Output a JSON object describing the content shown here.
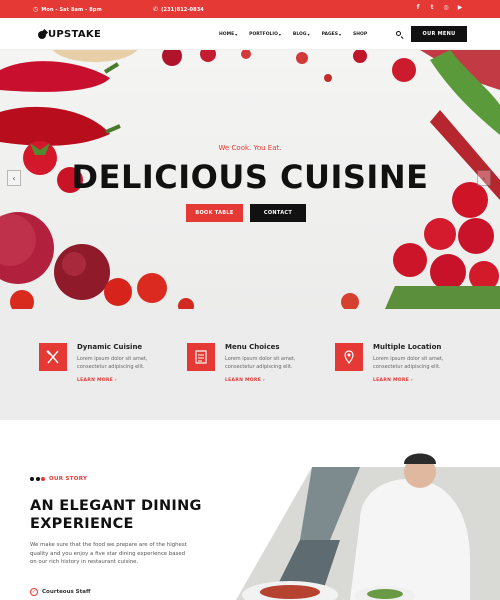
{
  "topbar": {
    "hours": "Mon - Sat 8am - 8pm",
    "phone": "(231)812-0834",
    "socials": [
      {
        "icon": "facebook-icon",
        "glyph": "f"
      },
      {
        "icon": "twitter-icon",
        "glyph": "t"
      },
      {
        "icon": "instagram-icon",
        "glyph": "◎"
      },
      {
        "icon": "youtube-icon",
        "glyph": "▶"
      }
    ]
  },
  "header": {
    "logo": "UPSTAKE",
    "nav": [
      {
        "label": "HOME",
        "has_dropdown": true
      },
      {
        "label": "PORTFOLIO",
        "has_dropdown": true
      },
      {
        "label": "BLOG",
        "has_dropdown": true
      },
      {
        "label": "PAGES",
        "has_dropdown": true
      },
      {
        "label": "SHOP",
        "has_dropdown": false
      }
    ],
    "menu_button": "OUR MENU"
  },
  "hero": {
    "eyebrow": "We Cook. You Eat.",
    "headline": "DELICIOUS CUISINE",
    "book_button": "BOOK TABLE",
    "contact_button": "CONTACT",
    "prev_arrow": "‹",
    "next_arrow": "›"
  },
  "features": [
    {
      "title": "Dynamic Cuisine",
      "desc": "Lorem ipsum dolor sit amet, consectetur adipiscing elit.",
      "link": "LEARN MORE ›",
      "icon": "utensils-icon"
    },
    {
      "title": "Menu Choices",
      "desc": "Lorem ipsum dolor sit amet, consectetur adipiscing elit.",
      "link": "LEARN MORE ›",
      "icon": "menu-list-icon"
    },
    {
      "title": "Multiple Location",
      "desc": "Lorem ipsum dolor sit amet, consectetur adipiscing elit.",
      "link": "LEARN MORE ›",
      "icon": "map-pin-icon"
    }
  ],
  "story": {
    "kicker": "OUR STORY",
    "title_line1": "AN ELEGANT DINING",
    "title_line2": "EXPERIENCE",
    "paragraph": "We make sure that the food we prepare are of the highest quality and you enjoy a five star dining experience based on our rich history in restaurant cuisine.",
    "checklist": [
      "Courteous Staff"
    ]
  },
  "colors": {
    "accent": "#e53935",
    "dark": "#111111",
    "panel": "#ececec"
  }
}
